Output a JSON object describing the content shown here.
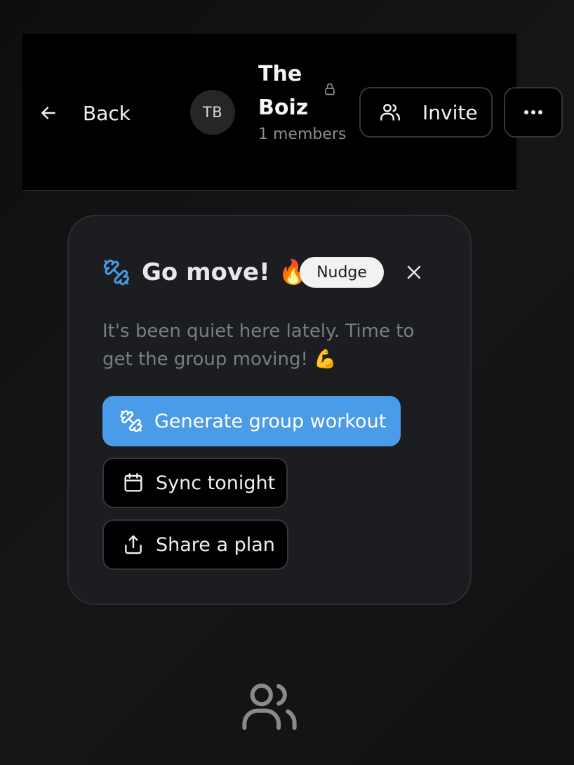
{
  "header": {
    "back_label": "Back",
    "avatar_initials": "TB",
    "group_name": "The Boiz",
    "member_count": "1 members",
    "invite_label": "Invite",
    "icons": {
      "back": "arrow-left-icon",
      "lock": "lock-icon",
      "invite": "users-icon",
      "more": "more-horizontal-icon"
    }
  },
  "nudge_card": {
    "title": "Go move! 🔥",
    "badge": "Nudge",
    "message": "It's been quiet here lately. Time to get the group moving! 💪",
    "primary_action": "Generate group workout",
    "sync_action": "Sync tonight",
    "share_action": "Share a plan",
    "icons": {
      "title": "dumbbell-icon",
      "close": "close-icon",
      "primary": "dumbbell-icon",
      "sync": "calendar-icon",
      "share": "share-icon"
    }
  },
  "empty_state": {
    "icon": "users-icon"
  },
  "colors": {
    "background": "#111112",
    "header_background": "#000000",
    "card_background": "#1b1d20",
    "accent": "#4a9be8",
    "muted_text": "#7a7d83"
  }
}
